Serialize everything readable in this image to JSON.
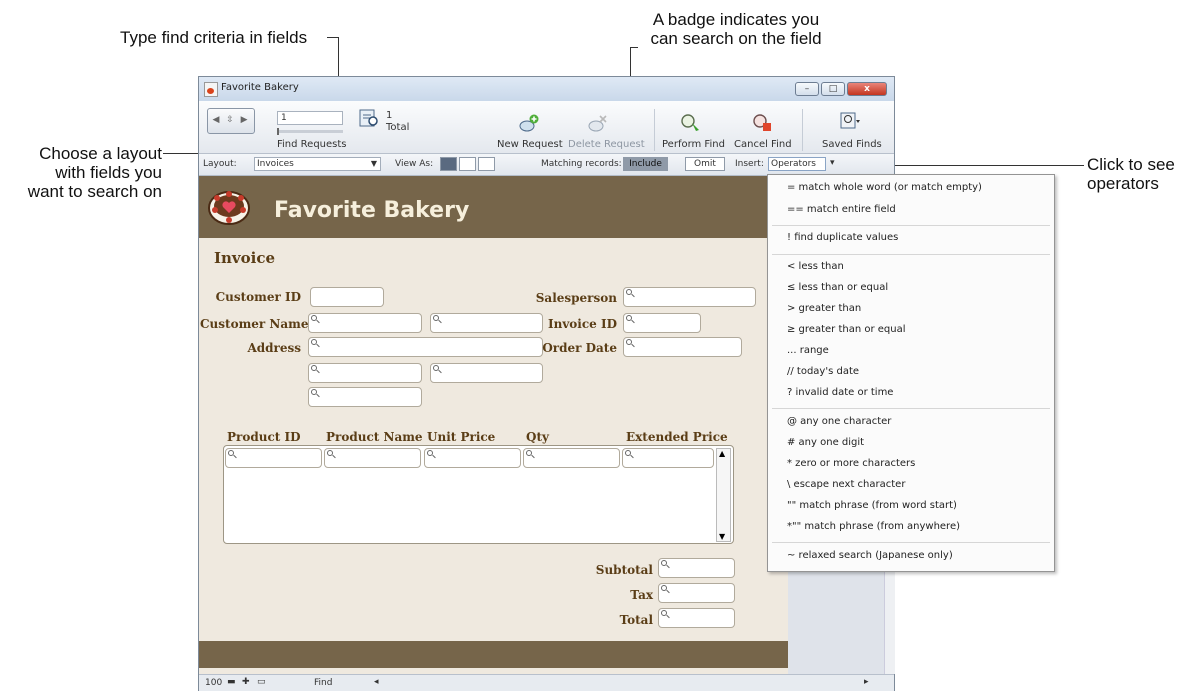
{
  "callouts": {
    "type_find": "Type find criteria in fields",
    "badge_line1": "A badge indicates you",
    "badge_line2": "can search on the field",
    "choose_line1": "Choose a layout",
    "choose_line2": "with fields you",
    "choose_line3": "want to search on",
    "click_line1": "Click to see",
    "click_line2": "operators"
  },
  "window": {
    "title": "Favorite Bakery",
    "controls": {
      "minimize": "–",
      "maximize": "□",
      "close": "x"
    }
  },
  "toolbar": {
    "record_value": "1",
    "find_requests_label": "Find Requests",
    "total_count": "1",
    "total_label": "Total",
    "new_request": "New Request",
    "delete_request": "Delete Request",
    "perform_find": "Perform Find",
    "cancel_find": "Cancel Find",
    "saved_finds": "Saved Finds"
  },
  "layoutbar": {
    "layout_label": "Layout:",
    "layout_value": "Invoices",
    "view_as_label": "View As:",
    "matching_label": "Matching records:",
    "include": "Include",
    "omit": "Omit",
    "insert_label": "Insert:",
    "operators": "Operators"
  },
  "layout": {
    "header_title": "Favorite Bakery",
    "section_title": "Invoice",
    "labels": {
      "customer_id": "Customer ID",
      "customer_name": "Customer Name",
      "address": "Address",
      "salesperson": "Salesperson",
      "invoice_id": "Invoice ID",
      "order_date": "Order Date",
      "subtotal": "Subtotal",
      "tax": "Tax",
      "total": "Total"
    },
    "portal_columns": [
      "Product ID",
      "Product Name",
      "Unit Price",
      "Qty",
      "Extended Price"
    ]
  },
  "statusbar": {
    "zoom": "100",
    "mode": "Find"
  },
  "operators_menu": {
    "groups": [
      [
        "=  match whole word (or match empty)",
        "==  match entire field"
      ],
      [
        "!  find duplicate values"
      ],
      [
        "<  less than",
        "≤  less than or equal",
        ">  greater than",
        "≥  greater than or equal",
        "... range",
        "//  today's date",
        "?  invalid date or time"
      ],
      [
        "@  any one character",
        "#  any one digit",
        "*  zero or more characters",
        "\\  escape next character",
        "\"\"  match phrase (from word start)",
        "*\"\"  match phrase (from anywhere)"
      ],
      [
        "~  relaxed search (Japanese only)"
      ]
    ]
  }
}
